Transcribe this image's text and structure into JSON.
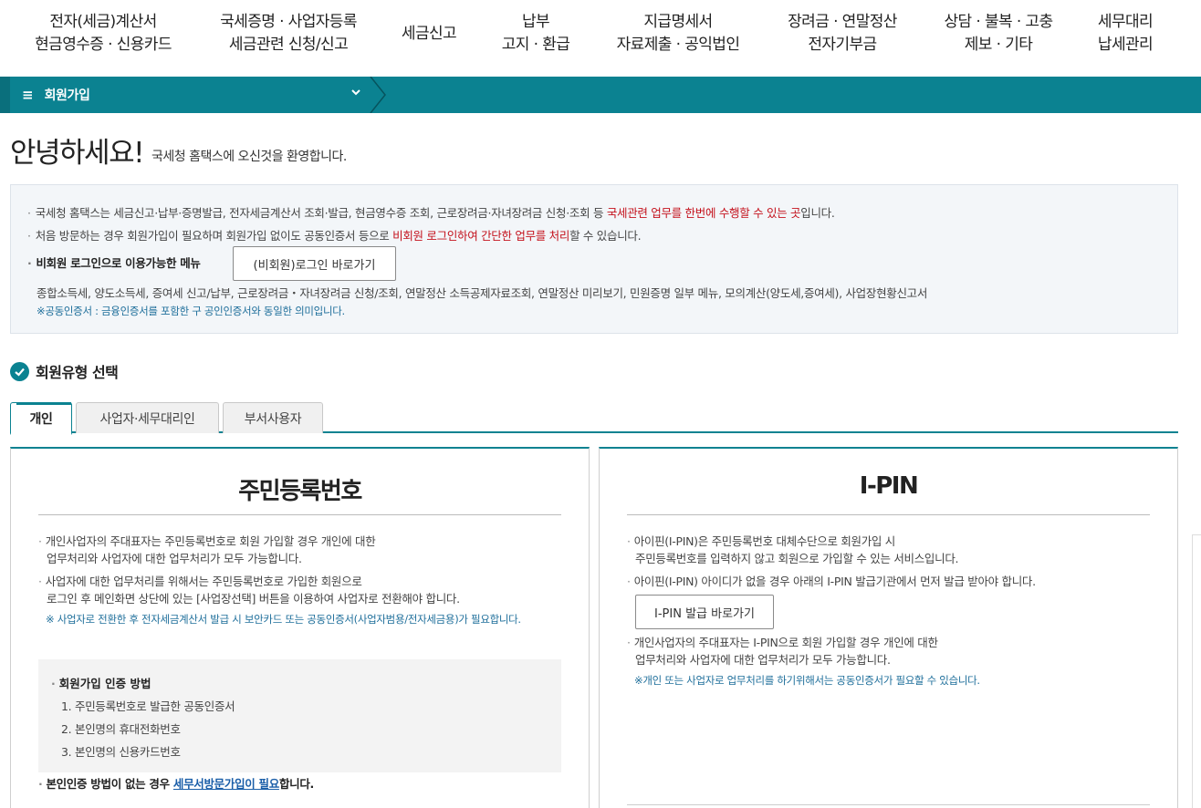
{
  "topnav": [
    {
      "l1": "전자(세금)계산서",
      "l2": "현금영수증 · 신용카드"
    },
    {
      "l1": "국세증명 · 사업자등록",
      "l2": "세금관련 신청/신고"
    },
    {
      "l1": "세금신고",
      "l2": ""
    },
    {
      "l1": "납부",
      "l2": "고지 · 환급"
    },
    {
      "l1": "지급명세서",
      "l2": "자료제출 · 공익법인"
    },
    {
      "l1": "장려금 · 연말정산",
      "l2": "전자기부금"
    },
    {
      "l1": "상담 · 불복 · 고충",
      "l2": "제보 · 기타"
    },
    {
      "l1": "세무대리",
      "l2": "납세관리"
    }
  ],
  "location": {
    "hamburger": "≡",
    "label": "회원가입"
  },
  "greeting": {
    "title": "안녕하세요!",
    "subtitle": "국세청 홈택스에 오신것을 환영합니다."
  },
  "info": {
    "l1_a": "국세청 홈택스는 세금신고·납부·증명발급, 전자세금계산서 조회·발급, 현금영수증 조회, 근로장려금·자녀장려금 신청·조회 등 ",
    "l1_red": "국세관련 업무를 한번에 수행할 수 있는 곳",
    "l1_b": "입니다.",
    "l2_a": "처음 방문하는 경우 회원가입이 필요하며 회원가입 없이도 공동인증서 등으로 ",
    "l2_red": "비회원 로그인하여 간단한 업무를 처리",
    "l2_b": "할 수 있습니다.",
    "l3": "비회원 로그인으로 이용가능한 메뉴",
    "nonmember_button": "(비회원)로그인 바로가기",
    "menus": "종합소득세, 양도소득세, 증여세 신고/납부, 근로장려금・자녀장려금 신청/조회, 연말정산 소득공제자료조회, 연말정산 미리보기, 민원증명 일부 메뉴, 모의계산(양도세,증여세), 사업장현황신고서",
    "note": "※공동인증서 : 금융인증서를 포함한 구 공인인증서와 동일한 의미입니다."
  },
  "section": {
    "title": "회원유형 선택"
  },
  "tabs": [
    "개인",
    "사업자·세무대리인",
    "부서사용자"
  ],
  "resident": {
    "title": "주민등록번호",
    "p1a": "개인사업자의 주대표자는 주민등록번호로 회원 가입할 경우 개인에 대한",
    "p1b": "업무처리와 사업자에 대한 업무처리가 모두 가능합니다.",
    "p2a": "사업자에 대한 업무처리를 위해서는 주민등록번호로 가입한 회원으로",
    "p2b": "로그인 후 메인화면 상단에 있는 [사업장선택] 버튼을 이용하여 사업자로 전환해야 합니다.",
    "note": "※ 사업자로 전환한 후 전자세금계산서 발급 시 보안카드 또는 공동인증서(사업자범용/전자세금용)가 필요합니다.",
    "auth_head": "회원가입 인증 방법",
    "auth_items": [
      "1. 주민등록번호로 발급한 공동인증서",
      "2. 본인명의 휴대전화번호",
      "3. 본인명의 신용카드번호"
    ],
    "bottom_a": "본인인증 방법이 없는 경우 ",
    "bottom_link": "세무서방문가입이 필요",
    "bottom_b": "합니다."
  },
  "ipin": {
    "title": "I-PIN",
    "p1a": "아이핀(I-PIN)은 주민등록번호 대체수단으로 회원가입 시",
    "p1b": "주민등록번호를 입력하지 않고 회원으로 가입할 수 있는 서비스입니다.",
    "p2": "아이핀(I-PIN) 아이디가 없을 경우 아래의 I-PIN 발급기관에서 먼저 발급 받아야 합니다.",
    "button": "I-PIN 발급 바로가기",
    "p3a": "개인사업자의 주대표자는 I-PIN으로 회원 가입할 경우 개인에 대한",
    "p3b": "업무처리와 사업자에 대한 업무처리가 모두 가능합니다.",
    "note": "※개인 또는 사업자로 업무처리를 하기위해서는 공동인증서가 필요할 수 있습니다."
  }
}
